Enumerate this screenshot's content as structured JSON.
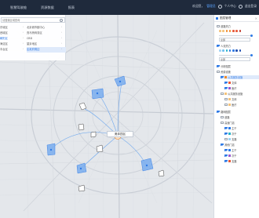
{
  "topbar": {
    "nav": [
      "智慧驾驶舱",
      "资源数据",
      "报表"
    ],
    "welcome": "欢迎您，",
    "user": "管理员",
    "personal": "个人中心",
    "logout": "退出登录"
  },
  "left_panel": {
    "search_placeholder": "请搜索区域查询",
    "col1": [
      {
        "label": "东城区",
        "selected": false
      },
      {
        "label": "西城区",
        "selected": false
      },
      {
        "label": "朝阳区",
        "selected": true
      },
      {
        "label": "海淀区",
        "selected": false
      },
      {
        "label": "丰台区",
        "selected": false
      }
    ],
    "col2": [
      {
        "label": "北京城市副中心",
        "active": false
      },
      {
        "label": "亮马桥商务区",
        "active": false
      },
      {
        "label": "CBD",
        "active": false
      },
      {
        "label": "望京地区",
        "active": false
      },
      {
        "label": "区政府周边",
        "active": true
      }
    ]
  },
  "map": {
    "popup_label": "奥体园区",
    "accent": "#2f7ae5",
    "marker_color": "#f08a2a"
  },
  "right_panel": {
    "title": "图层管理",
    "close": "×",
    "sections": {
      "heat": "道路热力",
      "heat_level": "热力等级",
      "heat_select": "全部",
      "people": "人流热力",
      "people_select": "全部",
      "analysis": "分析图层",
      "resource": "资源设施",
      "selected_row": "公共服务设施",
      "sub_a": "文体",
      "sub_b": "医疗",
      "sub_c": "公共服务设施",
      "sub_d": "文体",
      "sub_e": "医疗",
      "layer2": "路网图层",
      "road": "道路",
      "r1": "高速门店",
      "r2": "主干",
      "r3": "次干",
      "r4": "支路",
      "r5": "其他门店",
      "r6": "主干",
      "r7": "次干",
      "r8": "支路"
    },
    "swatch_colors": [
      "#f4c27a",
      "#f08a2a",
      "#e85a3a",
      "#9b59d0",
      "#2f7ae5",
      "#27b3c9"
    ]
  }
}
